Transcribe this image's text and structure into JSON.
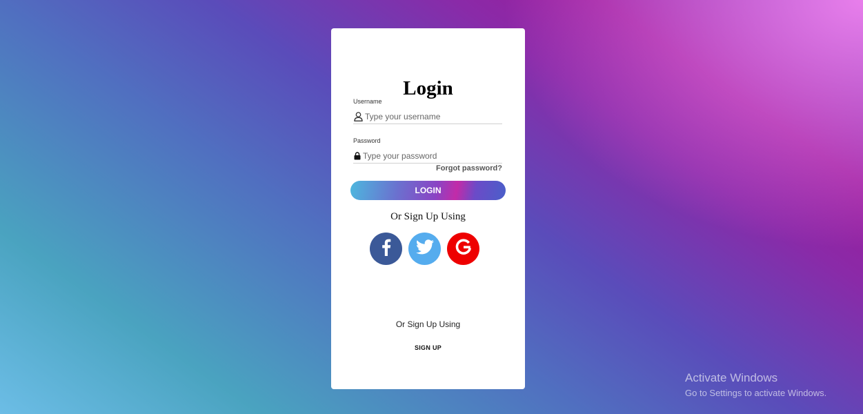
{
  "login_form": {
    "title": "Login",
    "username": {
      "label": "Username",
      "placeholder": "Type your username",
      "value": "",
      "icon": "user-icon"
    },
    "password": {
      "label": "Password",
      "placeholder": "Type your password",
      "value": "",
      "icon": "lock-icon"
    },
    "forgot_label": "Forgot password?",
    "login_label": "LOGIN",
    "social_prompt": "Or Sign Up Using",
    "socials": [
      {
        "name": "facebook",
        "icon": "facebook-icon",
        "color": "#3b5998"
      },
      {
        "name": "twitter",
        "icon": "twitter-icon",
        "color": "#55acee"
      },
      {
        "name": "google",
        "icon": "google-icon",
        "color": "#ee0000"
      }
    ],
    "signup_prompt": "Or Sign Up Using",
    "signup_label": "SIGN UP"
  },
  "watermark": {
    "line1": "Activate Windows",
    "line2": "Go to Settings to activate Windows."
  },
  "colors": {
    "card_background": "#ffffff",
    "facebook": "#3b5998",
    "twitter": "#55acee",
    "google": "#ee0000"
  }
}
